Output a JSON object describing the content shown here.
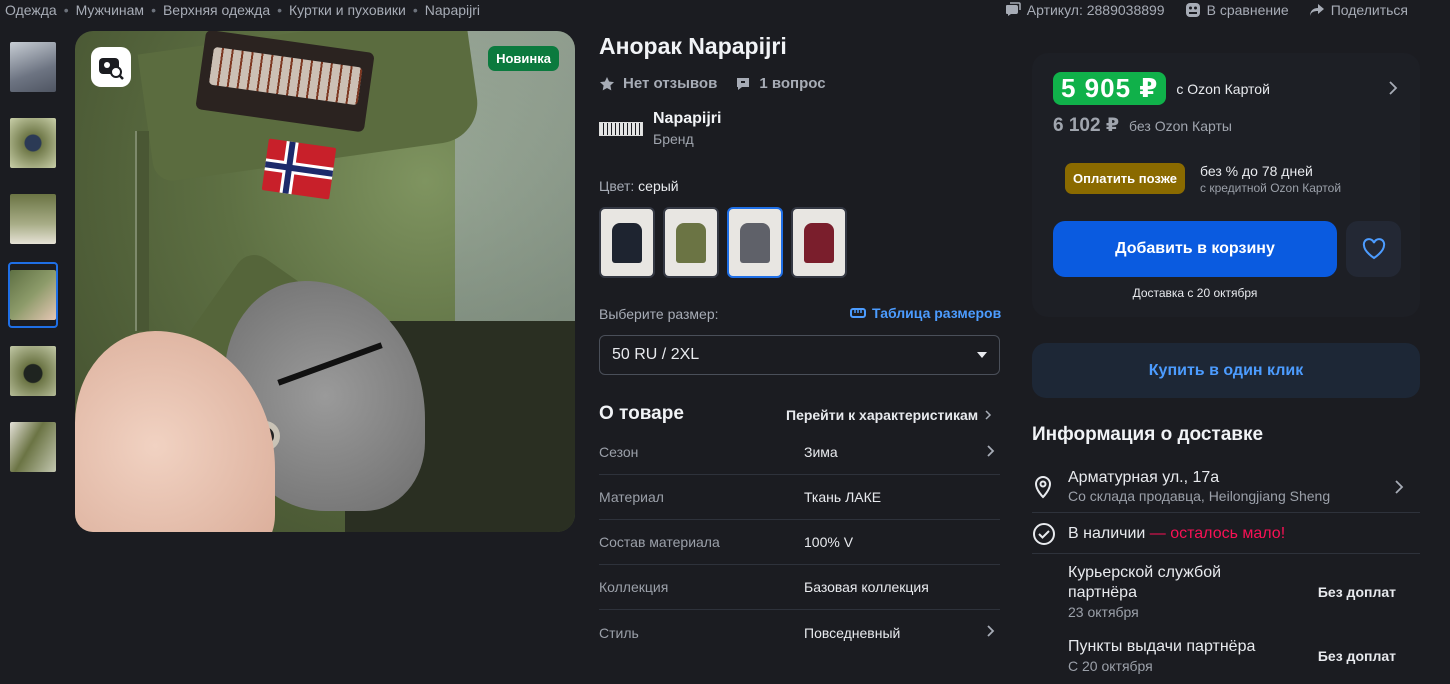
{
  "breadcrumb": [
    "Одежда",
    "Мужчинам",
    "Верхняя одежда",
    "Куртки и пуховики",
    "Napapijri"
  ],
  "top_actions": {
    "article": "Артикул: 2889038899",
    "compare": "В сравнение",
    "share": "Поделиться"
  },
  "product": {
    "title": "Анорак Napapijri",
    "badge": "Новинка",
    "reviews": "Нет отзывов",
    "questions": "1 вопрос",
    "brand_name": "Napapijri",
    "brand_sub": "Бренд",
    "color_label": "Цвет:",
    "color_value": "серый",
    "swatch_colors": [
      "#1e2430",
      "#6b7444",
      "#5f6169",
      "#7a1e2c"
    ],
    "selected_swatch": 3,
    "size_label": "Выберите размер:",
    "size_table": "Таблица размеров",
    "size_value": "50 RU / 2XL"
  },
  "about": {
    "title": "О товаре",
    "goto": "Перейти к характеристикам",
    "specs": [
      {
        "k": "Сезон",
        "v": "Зима"
      },
      {
        "k": "Материал",
        "v": "Ткань ЛАКЕ"
      },
      {
        "k": "Состав материала",
        "v": "100% V"
      },
      {
        "k": "Коллекция",
        "v": "Базовая коллекция"
      },
      {
        "k": "Стиль",
        "v": "Повседневный"
      }
    ]
  },
  "price": {
    "main": "5 905 ₽",
    "main_note": "с Ozon Картой",
    "old": "6 102 ₽",
    "old_note": "без Ozon Карты",
    "pay_later": "Оплатить позже",
    "pay_info_a": "без % до 78 дней",
    "pay_info_b": "с кредитной Ozon Картой",
    "add_cart": "Добавить в корзину",
    "delivery_note": "Доставка с 20 октября",
    "one_click": "Купить в один клик"
  },
  "delivery": {
    "title": "Информация о доставке",
    "address": "Арматурная ул., 17а",
    "from": "Со склада продавца, Heilongjiang Sheng",
    "in_stock": "В наличии",
    "stock_warn": " — осталось мало!",
    "options": [
      {
        "name": "Курьерской службой партнёра",
        "date": "23 октября",
        "price": "Без доплат"
      },
      {
        "name": "Пункты выдачи партнёра",
        "date": "С 20 октября",
        "price": "Без доплат"
      }
    ]
  },
  "colors": {
    "bg": "#1b1c21",
    "accent_blue": "#0a5be0",
    "link_blue": "#4c9cff",
    "price_green": "#10b14a",
    "warn_pink": "#f91155"
  }
}
